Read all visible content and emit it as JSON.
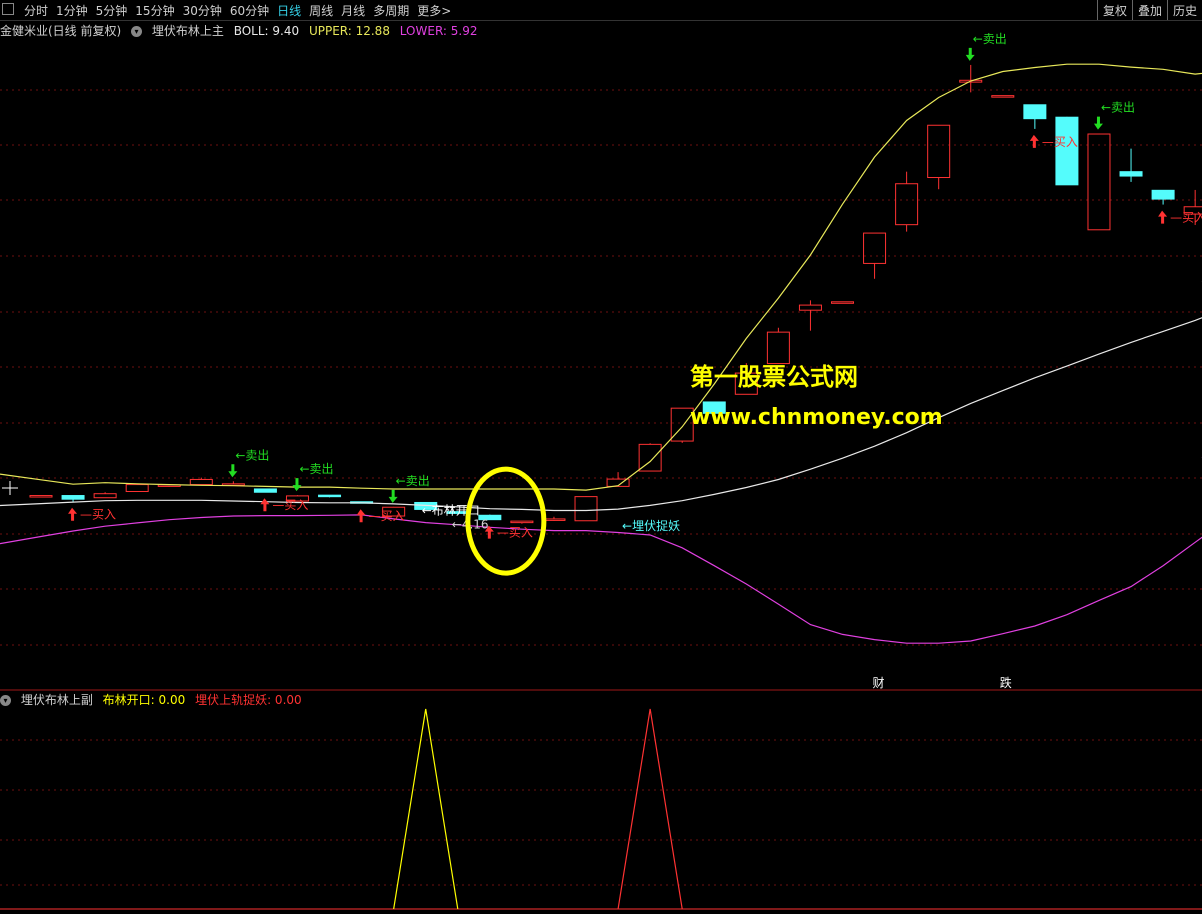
{
  "toolbar": {
    "periods": [
      "分时",
      "1分钟",
      "5分钟",
      "15分钟",
      "30分钟",
      "60分钟",
      "日线",
      "周线",
      "月线",
      "多周期",
      "更多>"
    ],
    "active_period": "日线",
    "right_buttons": [
      "复权",
      "叠加",
      "历史"
    ]
  },
  "main_title": {
    "stock": "金健米业(日线 前复权)",
    "indicator": "埋伏布林上主",
    "boll": "BOLL: 9.40",
    "upper": "UPPER: 12.88",
    "lower": "LOWER: 5.92"
  },
  "sub_title": {
    "indicator": "埋伏布林上副",
    "open": "布林开口: 0.00",
    "catch": "埋伏上轨捉妖: 0.00"
  },
  "watermark": {
    "line1": "第一股票公式网",
    "line2": "www.chnmoney.com"
  },
  "labels": {
    "buy": "买入",
    "sell": "卖出",
    "boll_open": "←布林开口",
    "ambush": "←埋伏捉妖",
    "low_price": "←4.16",
    "cai": "财",
    "die": "跌"
  },
  "colors": {
    "up": "#ff3232",
    "down": "#54fcfc",
    "upper": "#e8e85a",
    "mid": "#e8e8e8",
    "lower": "#e040e0",
    "buy": "#ff3232",
    "sell": "#22dd22",
    "highlight": "#ffff00",
    "grid": "#6e1010"
  },
  "chart_data": {
    "type": "candlestick",
    "candles": [
      {
        "o": 9.62,
        "h": 9.62,
        "l": 9.62,
        "c": 9.62
      },
      {
        "o": 9.62,
        "h": 9.58,
        "l": 9.45,
        "c": 9.52
      },
      {
        "o": 9.56,
        "h": 9.71,
        "l": 9.56,
        "c": 9.67
      },
      {
        "o": 9.73,
        "h": 9.94,
        "l": 9.72,
        "c": 9.92
      },
      {
        "o": 9.89,
        "h": 9.93,
        "l": 9.86,
        "c": 9.91
      },
      {
        "o": 9.92,
        "h": 10.11,
        "l": 9.92,
        "c": 10.06
      },
      {
        "o": 9.93,
        "h": 10.01,
        "l": 9.93,
        "c": 9.94
      },
      {
        "o": 9.8,
        "h": 9.8,
        "l": 9.71,
        "c": 9.71
      },
      {
        "o": 9.47,
        "h": 9.63,
        "l": 9.47,
        "c": 9.61
      },
      {
        "o": 9.63,
        "h": 9.63,
        "l": 9.57,
        "c": 9.59
      },
      {
        "o": 9.45,
        "h": 9.45,
        "l": 9.41,
        "c": 9.41
      },
      {
        "o": 9.06,
        "h": 9.31,
        "l": 9.06,
        "c": 9.3
      },
      {
        "o": 9.43,
        "h": 9.43,
        "l": 9.24,
        "c": 9.24
      },
      {
        "o": 9.18,
        "h": 9.19,
        "l": 9.13,
        "c": 9.13
      },
      {
        "o": 9.08,
        "h": 9.1,
        "l": 8.96,
        "c": 8.96
      },
      {
        "o": 8.89,
        "h": 8.92,
        "l": 8.85,
        "c": 8.92
      },
      {
        "o": 8.94,
        "h": 9.04,
        "l": 8.93,
        "c": 8.98
      },
      {
        "o": 8.93,
        "h": 9.6,
        "l": 8.93,
        "c": 9.59
      },
      {
        "o": 9.87,
        "h": 10.26,
        "l": 9.87,
        "c": 10.07
      },
      {
        "o": 10.29,
        "h": 11.05,
        "l": 10.29,
        "c": 11.02
      },
      {
        "o": 11.11,
        "h": 12.0,
        "l": 11.06,
        "c": 12.01
      },
      {
        "o": 12.18,
        "h": 12.18,
        "l": 11.87,
        "c": 11.87
      },
      {
        "o": 12.39,
        "h": 13.24,
        "l": 12.39,
        "c": 12.97
      },
      {
        "o": 13.23,
        "h": 14.21,
        "l": 13.23,
        "c": 14.09
      },
      {
        "o": 14.69,
        "h": 14.96,
        "l": 14.13,
        "c": 14.83
      },
      {
        "o": 14.92,
        "h": 14.92,
        "l": 14.92,
        "c": 14.92
      },
      {
        "o": 15.97,
        "h": 16.8,
        "l": 15.55,
        "c": 16.8
      },
      {
        "o": 17.03,
        "h": 18.48,
        "l": 16.84,
        "c": 18.15
      },
      {
        "o": 18.32,
        "h": 19.74,
        "l": 18.0,
        "c": 19.75
      },
      {
        "o": 20.93,
        "h": 21.4,
        "l": 20.65,
        "c": 20.98
      },
      {
        "o": 20.56,
        "h": 20.56,
        "l": 20.56,
        "c": 20.56
      },
      {
        "o": 20.31,
        "h": 20.09,
        "l": 19.65,
        "c": 19.93
      },
      {
        "o": 19.97,
        "h": 19.98,
        "l": 18.12,
        "c": 18.12
      },
      {
        "o": 16.89,
        "h": 19.52,
        "l": 16.9,
        "c": 19.51
      },
      {
        "o": 18.48,
        "h": 19.11,
        "l": 18.2,
        "c": 18.36
      },
      {
        "o": 17.97,
        "h": 17.97,
        "l": 17.58,
        "c": 17.73
      },
      {
        "o": 17.32,
        "h": 17.98,
        "l": 17.02,
        "c": 17.52
      },
      {
        "o": 17.73,
        "h": 17.52,
        "l": 17.36,
        "c": 17.52
      },
      {
        "o": 19.33,
        "h": 19.62,
        "l": 17.58,
        "c": 17.62
      }
    ],
    "upper": [
      10.05,
      9.93,
      9.97,
      9.94,
      9.92,
      9.9,
      9.89,
      9.87,
      9.85,
      9.85,
      9.82,
      9.8,
      9.8,
      9.8,
      9.8,
      9.8,
      9.8,
      9.77,
      9.89,
      10.55,
      11.5,
      12.67,
      13.92,
      15.02,
      16.2,
      17.59,
      18.88,
      19.88,
      20.51,
      20.96,
      21.22,
      21.33,
      21.42,
      21.42,
      21.34,
      21.28,
      21.15,
      21.24,
      21.21
    ],
    "mid": [
      9.4,
      9.44,
      9.48,
      9.49,
      9.49,
      9.49,
      9.47,
      9.45,
      9.43,
      9.42,
      9.42,
      9.39,
      9.35,
      9.31,
      9.26,
      9.24,
      9.21,
      9.21,
      9.25,
      9.35,
      9.48,
      9.65,
      9.84,
      10.06,
      10.34,
      10.64,
      10.97,
      11.34,
      11.75,
      12.14,
      12.49,
      12.84,
      13.16,
      13.49,
      13.81,
      14.11,
      14.41,
      14.75,
      15.07
    ],
    "lower": [
      8.5,
      8.65,
      8.78,
      8.87,
      8.96,
      9.02,
      9.06,
      9.07,
      9.07,
      9.08,
      9.09,
      8.98,
      8.88,
      8.82,
      8.75,
      8.7,
      8.66,
      8.66,
      8.61,
      8.54,
      8.19,
      7.7,
      7.2,
      6.65,
      6.09,
      5.82,
      5.68,
      5.58,
      5.58,
      5.64,
      5.84,
      6.05,
      6.36,
      6.75,
      7.13,
      7.7,
      8.34,
      8.97,
      9.71
    ],
    "signals": [
      {
        "i": 1,
        "type": "buy"
      },
      {
        "i": 6,
        "type": "sell"
      },
      {
        "i": 7,
        "type": "buy"
      },
      {
        "i": 8,
        "type": "sell"
      },
      {
        "i": 10,
        "type": "buy"
      },
      {
        "i": 11,
        "type": "sell"
      },
      {
        "i": 14,
        "type": "buy"
      },
      {
        "i": 29,
        "type": "sell"
      },
      {
        "i": 31,
        "type": "buy"
      },
      {
        "i": 33,
        "type": "sell"
      },
      {
        "i": 35,
        "type": "buy"
      }
    ],
    "ambush_index": 17,
    "boll_open_index": 12,
    "low_index": 13,
    "cai_index": 26,
    "die_index": 30,
    "sub_series": {
      "boll_open": {
        "peak_index": 12,
        "value": 1
      },
      "catch": {
        "peak_index": 19,
        "value": 1
      }
    }
  }
}
